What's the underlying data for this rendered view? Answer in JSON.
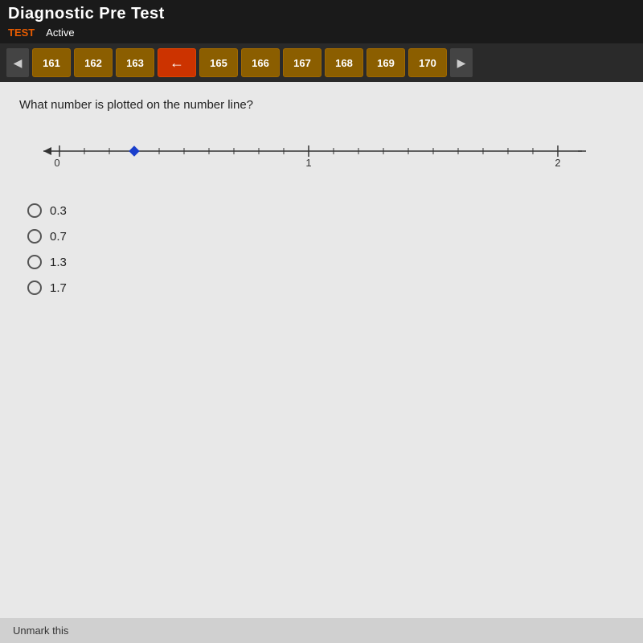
{
  "header": {
    "title": "Diagnostic Pre Test",
    "status_test": "TEST",
    "status_active": "Active"
  },
  "nav": {
    "prev_arrow": "◀",
    "next_arrow": "▶",
    "back_label": "←",
    "buttons": [
      {
        "id": 161,
        "label": "161",
        "active": false
      },
      {
        "id": 162,
        "label": "162",
        "active": false
      },
      {
        "id": 163,
        "label": "163",
        "active": false
      },
      {
        "id": 164,
        "label": "←",
        "active": true,
        "is_back": true
      },
      {
        "id": 165,
        "label": "165",
        "active": false
      },
      {
        "id": 166,
        "label": "166",
        "active": false
      },
      {
        "id": 167,
        "label": "167",
        "active": false
      },
      {
        "id": 168,
        "label": "168",
        "active": false
      },
      {
        "id": 169,
        "label": "169",
        "active": false
      },
      {
        "id": 170,
        "label": "170",
        "active": false
      }
    ]
  },
  "question": {
    "text": "What number is plotted on the number line?",
    "number_line": {
      "min": 0,
      "max": 2,
      "ticks": 20,
      "marked_value": 0.3,
      "labels": [
        0,
        1,
        2
      ]
    },
    "options": [
      {
        "value": "0.3",
        "label": "0.3"
      },
      {
        "value": "0.7",
        "label": "0.7"
      },
      {
        "value": "1.3",
        "label": "1.3"
      },
      {
        "value": "1.7",
        "label": "1.7"
      }
    ]
  },
  "bottom": {
    "unmark_label": "Unmark this"
  }
}
